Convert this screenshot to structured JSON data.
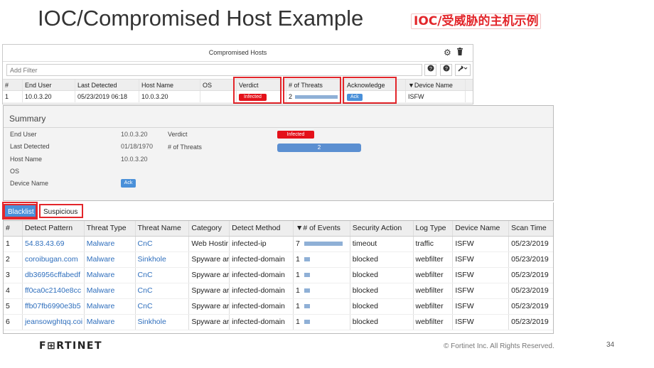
{
  "slide": {
    "title": "IOC/Compromised Host Example",
    "cn_title": "IOC/受威胁的主机示例"
  },
  "compromised_panel": {
    "title": "Compromised Hosts",
    "filter_placeholder": "Add Filter",
    "icons": {
      "gear": "⚙",
      "trash": "🗑",
      "circle": "❶",
      "help": "❓",
      "wrench": "✎"
    },
    "columns": [
      "#",
      "End User",
      "Last Detected",
      "Host Name",
      "OS",
      "Verdict",
      "# of Threats",
      "Acknowledge",
      "▼Device Name"
    ],
    "rows": [
      {
        "num": "1",
        "end_user": "10.0.3.20",
        "last_detected": "05/23/2019 06:18",
        "host_name": "10.0.3.20",
        "os": "",
        "verdict": "Infected",
        "threats": "2",
        "acknowledge": "Ack",
        "device_name": "ISFW"
      }
    ]
  },
  "summary": {
    "title": "Summary",
    "end_user_label": "End User",
    "end_user_value": "10.0.3.20",
    "last_detected_label": "Last Detected",
    "last_detected_value": "01/18/1970",
    "host_name_label": "Host Name",
    "host_name_value": "10.0.3.20",
    "os_label": "OS",
    "device_name_label": "Device Name",
    "ack_label": "Ack",
    "verdict_label": "Verdict",
    "verdict_value": "Infected",
    "threats_label": "# of Threats",
    "threats_value": "2"
  },
  "tabs": {
    "blacklist": "Blacklist",
    "suspicious": "Suspicious"
  },
  "threats_table": {
    "columns": [
      "#",
      "Detect Pattern",
      "Threat Type",
      "Threat Name",
      "Category",
      "Detect Method",
      "▼# of Events",
      "Security Action",
      "Log Type",
      "Device Name",
      "Scan Time"
    ],
    "rows": [
      {
        "num": "1",
        "pattern": "54.83.43.69",
        "ttype": "Malware",
        "tname": "CnC",
        "category": "Web Hostir",
        "method": "infected-ip",
        "events": "7",
        "events_level": 7,
        "action": "timeout",
        "log_type": "traffic",
        "device": "ISFW",
        "scan_time": "05/23/2019"
      },
      {
        "num": "2",
        "pattern": "coroibugan.com",
        "ttype": "Malware",
        "tname": "Sinkhole",
        "category": "Spyware ar",
        "method": "infected-domain",
        "events": "1",
        "events_level": 1,
        "action": "blocked",
        "log_type": "webfilter",
        "device": "ISFW",
        "scan_time": "05/23/2019"
      },
      {
        "num": "3",
        "pattern": "db36956cffabedf",
        "ttype": "Malware",
        "tname": "CnC",
        "category": "Spyware ar",
        "method": "infected-domain",
        "events": "1",
        "events_level": 1,
        "action": "blocked",
        "log_type": "webfilter",
        "device": "ISFW",
        "scan_time": "05/23/2019"
      },
      {
        "num": "4",
        "pattern": "ff0ca0c2140e8cc",
        "ttype": "Malware",
        "tname": "CnC",
        "category": "Spyware ar",
        "method": "infected-domain",
        "events": "1",
        "events_level": 1,
        "action": "blocked",
        "log_type": "webfilter",
        "device": "ISFW",
        "scan_time": "05/23/2019"
      },
      {
        "num": "5",
        "pattern": "ffb07fb6990e3b5",
        "ttype": "Malware",
        "tname": "CnC",
        "category": "Spyware ar",
        "method": "infected-domain",
        "events": "1",
        "events_level": 1,
        "action": "blocked",
        "log_type": "webfilter",
        "device": "ISFW",
        "scan_time": "05/23/2019"
      },
      {
        "num": "6",
        "pattern": "jeansowghtqq.coi",
        "ttype": "Malware",
        "tname": "Sinkhole",
        "category": "Spyware ar",
        "method": "infected-domain",
        "events": "1",
        "events_level": 1,
        "action": "blocked",
        "log_type": "webfilter",
        "device": "ISFW",
        "scan_time": "05/23/2019"
      }
    ]
  },
  "footer": {
    "logo": "F⊞RTINET",
    "copyright": "© Fortinet Inc. All Rights Reserved.",
    "page": "34"
  },
  "colors": {
    "highlight_red": "#e3262b",
    "infected": "#e4111a",
    "ack_blue": "#4a90d9",
    "bar_blue": "#8fb0d6"
  }
}
